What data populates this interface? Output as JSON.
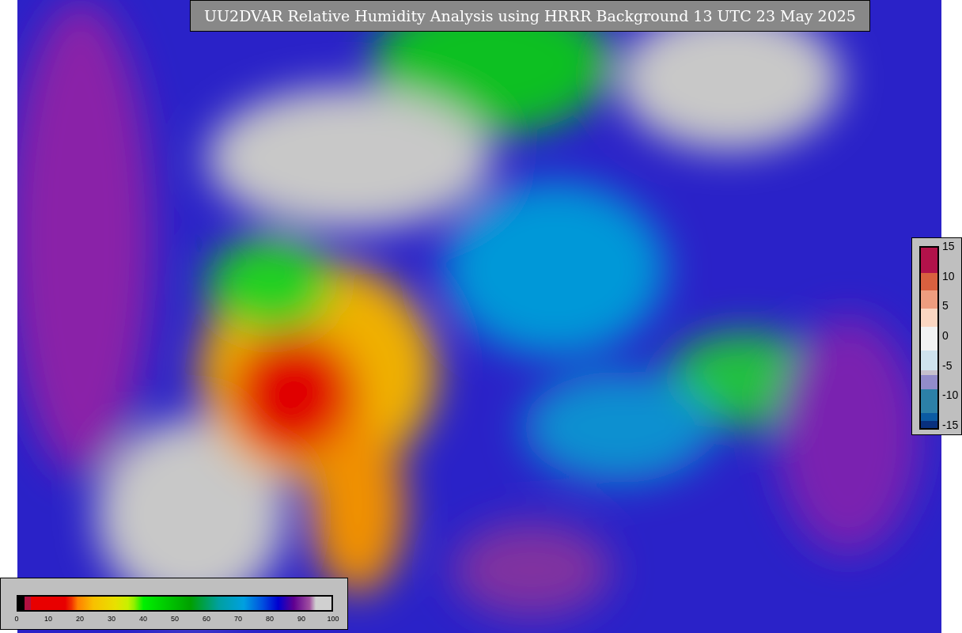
{
  "title": "UU2DVAR Relative Humidity Analysis using HRRR Background 13 UTC 23 May 2025",
  "humidity_colorbar": {
    "ticks": [
      "0",
      "10",
      "20",
      "30",
      "40",
      "50",
      "60",
      "70",
      "80",
      "90",
      "100"
    ]
  },
  "increment_colorbar": {
    "ticks": [
      "15",
      "10",
      "5",
      "0",
      "-5",
      "-10",
      "-15"
    ]
  }
}
